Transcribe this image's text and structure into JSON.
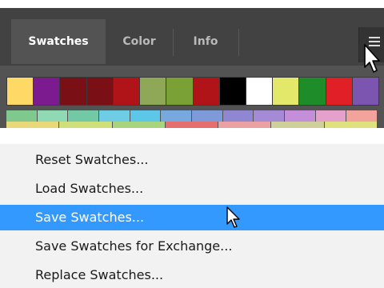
{
  "panel": {
    "tabs": [
      {
        "label": "Swatches",
        "active": true
      },
      {
        "label": "Color",
        "active": false
      },
      {
        "label": "Info",
        "active": false
      }
    ],
    "menu_icon": "hamburger-menu-icon",
    "swatches_row1": [
      "#ffd966",
      "#7b1b8f",
      "#7a0f15",
      "#7a0f15",
      "#b01418",
      "#8fa857",
      "#7aa136",
      "#b01418",
      "#000000",
      "#ffffff",
      "#e3e86a",
      "#1e8c29",
      "#e11f26",
      "#7b55b0"
    ],
    "swatches_row2": [
      "#7fc98f",
      "#8fd9b4",
      "#72c9a5",
      "#6ecde4",
      "#5cc7e8",
      "#77a9de",
      "#7f9ad8",
      "#8f87d2",
      "#a58ad6",
      "#c48fd8",
      "#e6a0cc",
      "#f2a39b"
    ],
    "swatches_row2_lower": [
      "#e8d87a",
      "#cfe07a",
      "#a8d47d",
      "#e56e6e",
      "#eba1a1",
      "#cfcf99",
      "#dfe07e"
    ]
  },
  "menu": {
    "items": [
      {
        "label": "Reset Swatches...",
        "selected": false
      },
      {
        "label": "Load Swatches...",
        "selected": false
      },
      {
        "label": "Save Swatches...",
        "selected": true
      },
      {
        "label": "Save Swatches for Exchange...",
        "selected": false
      },
      {
        "label": "Replace Swatches...",
        "selected": false
      }
    ]
  },
  "colors": {
    "highlight": "#3399ff",
    "panel_bg": "#535353",
    "tabbar_bg": "#424242"
  }
}
